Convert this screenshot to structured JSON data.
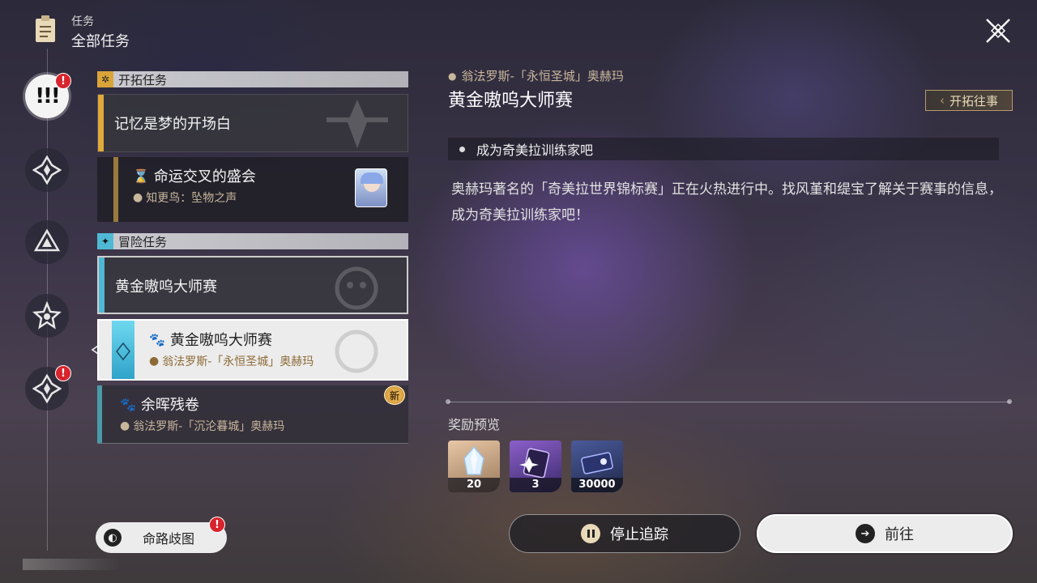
{
  "header": {
    "label": "任务",
    "title": "全部任务"
  },
  "sections": {
    "trailblaze": {
      "title": "开拓任务",
      "main_card": "记忆是梦的开场白",
      "sub_card": {
        "title": "命运交叉的盛会",
        "location": "知更鸟：坠物之声"
      }
    },
    "adventure": {
      "title": "冒险任务",
      "main_card": "黄金嗷呜大师赛",
      "sub_card_selected": {
        "title": "黄金嗷呜大师赛",
        "location": "翁法罗斯-「永恒圣城」奥赫玛"
      },
      "sub_card_2": {
        "title": "余晖残卷",
        "location": "翁法罗斯-「沉沦暮城」奥赫玛",
        "new_badge": "新"
      }
    }
  },
  "detail": {
    "location": "翁法罗斯-「永恒圣城」奥赫玛",
    "title": "黄金嗷呜大师赛",
    "trailblaze_button": "开拓往事",
    "objective": "成为奇美拉训练家吧",
    "description": "奥赫玛著名的「奇美拉世界锦标赛」正在火热进行中。找风堇和缇宝了解关于赛事的信息，成为奇美拉训练家吧！",
    "rewards_label": "奖励预览",
    "rewards": [
      {
        "icon": "crystal-icon",
        "count": "20"
      },
      {
        "icon": "pass-ticket-icon",
        "count": "3"
      },
      {
        "icon": "credit-icon",
        "count": "30000"
      }
    ]
  },
  "buttons": {
    "stop_tracking": "停止追踪",
    "go": "前往",
    "path_map": "命路歧图"
  },
  "badges": {
    "alert": "!"
  },
  "colors": {
    "trailblaze_accent": "#e0a93a",
    "adventure_accent": "#4fb8d4",
    "location_text": "#c9b79c",
    "alert_red": "#d8242c"
  }
}
